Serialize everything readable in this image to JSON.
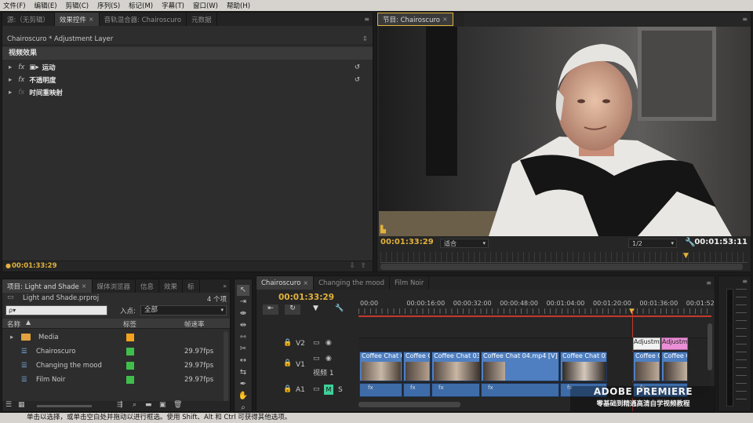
{
  "menu": [
    "文件(F)",
    "编辑(E)",
    "剪辑(C)",
    "序列(S)",
    "标记(M)",
    "字幕(T)",
    "窗口(W)",
    "帮助(H)"
  ],
  "source_panel": {
    "tabs": [
      "源:（无剪辑）",
      "效果控件",
      "音轨混合器: Chairoscuro",
      "元数据"
    ],
    "header": "Chairoscuro * Adjustment Layer",
    "section": "视频效果",
    "effects": [
      {
        "label": "运动",
        "fx": "fx"
      },
      {
        "label": "不透明度",
        "fx": "fx"
      },
      {
        "label": "时间重映射",
        "fx": "fx"
      }
    ],
    "timecode": "00:01:33:29"
  },
  "program": {
    "tab": "节目: Chairoscuro",
    "timecode": "00:01:33:29",
    "fit": "适合",
    "resolution": "1/2",
    "duration": "00:01:53:11"
  },
  "project": {
    "tabs": [
      "项目: Light and Shade",
      "媒体浏览器",
      "信息",
      "效果",
      "标"
    ],
    "filename": "Light and Shade.prproj",
    "count": "4 个项",
    "search_placeholder": "ρ▾",
    "in_label": "入点:",
    "in_value": "全部",
    "columns": [
      "名称",
      "标签",
      "帧速率"
    ],
    "items": [
      {
        "name": "Media",
        "type": "folder",
        "label_color": "#f3a21e",
        "fps": ""
      },
      {
        "name": "Chairoscuro",
        "type": "sequence",
        "label_color": "#3fbf4a",
        "fps": "29.97fps"
      },
      {
        "name": "Changing the mood",
        "type": "sequence",
        "label_color": "#3fbf4a",
        "fps": "29.97fps"
      },
      {
        "name": "Film Noir",
        "type": "sequence",
        "label_color": "#3fbf4a",
        "fps": "29.97fps"
      }
    ]
  },
  "timeline": {
    "tabs": [
      "Chairoscuro",
      "Changing the mood",
      "Film Noir"
    ],
    "timecode": "00:01:33:29",
    "ruler": [
      "00:00",
      "00:00:16:00",
      "00:00:32:00",
      "00:00:48:00",
      "00:01:04:00",
      "00:01:20:00",
      "00:01:36:00",
      "00:01:52:00"
    ],
    "tracks": {
      "v2": "V2",
      "v1": "V1",
      "v1_name": "视频 1",
      "a1": "A1",
      "a1_m": "M",
      "a1_s": "S"
    },
    "clips_v1": [
      "Coffee Chat 0",
      "Coffee C",
      "Coffee Chat 03",
      "Coffee Chat 04.mp4 [V]",
      "Coffee Chat 05",
      "Coffee C",
      "Coffee C"
    ],
    "clips_v2": [
      "Adjustm",
      "Adjustm"
    ]
  },
  "status_bar": "单击以选择，或单击空白处并拖动以进行框选。使用 Shift、Alt 和 Ctrl 可获得其他选项。",
  "watermark": {
    "title": "ADOBE PREMIERE",
    "subtitle": "零基础到精通高清自学视频教程"
  }
}
